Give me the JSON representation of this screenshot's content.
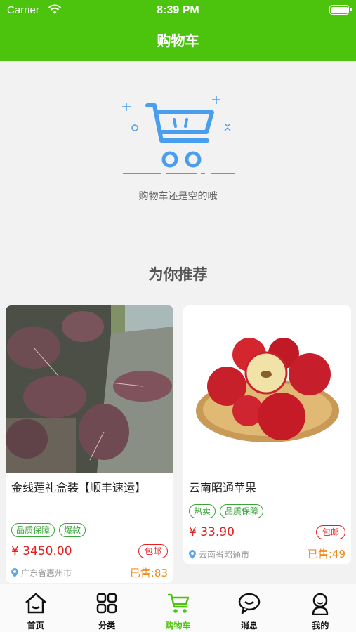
{
  "status_bar": {
    "carrier": "Carrier",
    "time": "8:39 PM"
  },
  "header": {
    "title": "购物车"
  },
  "empty_state": {
    "message": "购物车还是空的哦",
    "icon": "shopping-cart-icon"
  },
  "recommend": {
    "title": "为你推荐",
    "products": [
      {
        "name": "金线莲礼盒装【顺丰速运】",
        "tags": [
          "品质保障",
          "爆款"
        ],
        "price": "¥ 3450.00",
        "shipping": "包邮",
        "location": "广东省惠州市",
        "sold": "已售:83"
      },
      {
        "name": "云南昭通苹果",
        "tags": [
          "热卖",
          "品质保障"
        ],
        "price": "¥ 33.90",
        "shipping": "包邮",
        "location": "云南省昭通市",
        "sold": "已售:49"
      }
    ]
  },
  "tabbar": {
    "items": [
      {
        "label": "首页",
        "icon": "home-icon",
        "active": false
      },
      {
        "label": "分类",
        "icon": "grid-icon",
        "active": false
      },
      {
        "label": "购物车",
        "icon": "cart-icon",
        "active": true
      },
      {
        "label": "消息",
        "icon": "message-icon",
        "active": false
      },
      {
        "label": "我的",
        "icon": "profile-icon",
        "active": false
      }
    ]
  },
  "colors": {
    "brand": "#4cc30c",
    "price": "#e61e1e",
    "sold": "#f08a1c",
    "tag": "#3aa63a"
  }
}
